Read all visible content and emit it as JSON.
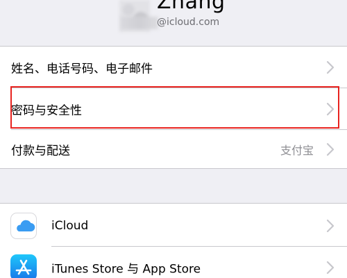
{
  "profile": {
    "name": "Zhang",
    "email_suffix": "@icloud.com"
  },
  "group1": {
    "rows": [
      {
        "label": "姓名、电话号码、电子邮件",
        "value": ""
      },
      {
        "label": "密码与安全性",
        "value": ""
      },
      {
        "label": "付款与配送",
        "value": "支付宝"
      }
    ]
  },
  "group2": {
    "rows": [
      {
        "label": "iCloud",
        "icon": "icloud-icon"
      },
      {
        "label": "iTunes Store 与 App Store",
        "icon": "app-store-icon"
      }
    ]
  },
  "colors": {
    "background": "#efeff4",
    "highlight": "#e8231f",
    "secondary_text": "#8e8e93"
  }
}
